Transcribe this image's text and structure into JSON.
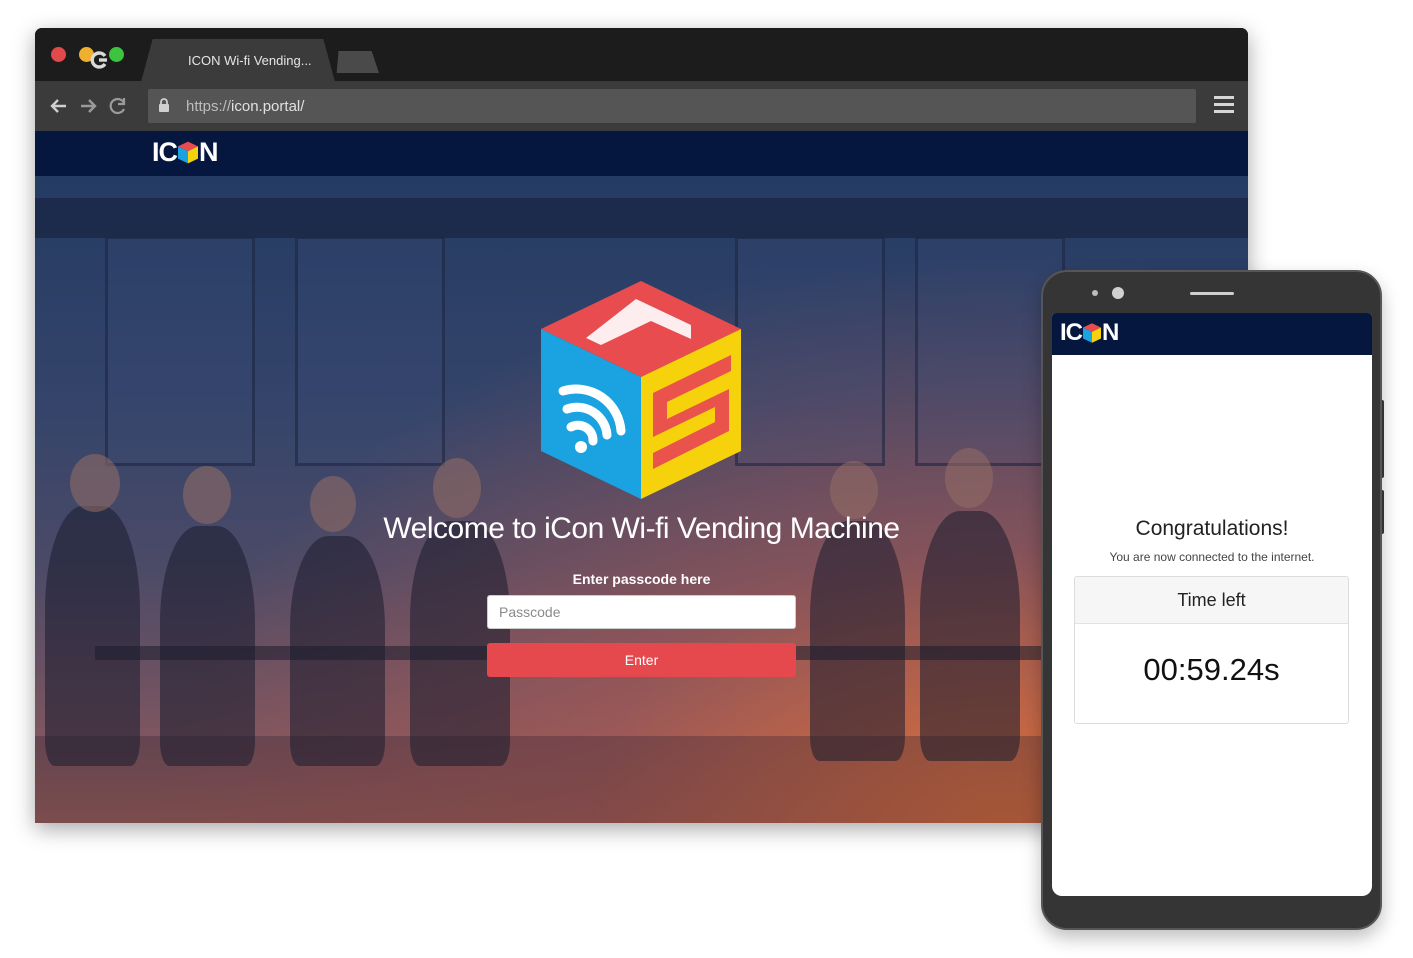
{
  "browser": {
    "tab_title": "ICON Wi-fi Vending...",
    "url_scheme": "https://",
    "url_host": "icon.portal/",
    "icons": [
      "back-arrow-icon",
      "forward-arrow-icon",
      "reload-icon",
      "lock-icon",
      "hamburger-menu-icon",
      "browser-tab-icon"
    ]
  },
  "site": {
    "brand_left": "IC",
    "brand_right": "N",
    "welcome": "Welcome to iCon Wi-fi Vending Machine",
    "prompt": "Enter passcode here",
    "passcode_placeholder": "Passcode",
    "passcode_value": "",
    "enter_label": "Enter"
  },
  "phone": {
    "brand_left": "IC",
    "brand_right": "N",
    "congrats": "Congratulations!",
    "connected": "You are now connected to the internet.",
    "time_left_label": "Time left",
    "time_left_value": "00:59.24s"
  },
  "colors": {
    "header_navy": "#06173f",
    "enter_red": "#e5484d",
    "cube_red": "#e84c4f",
    "cube_blue": "#1aa3e0",
    "cube_yellow": "#f5d20c"
  }
}
